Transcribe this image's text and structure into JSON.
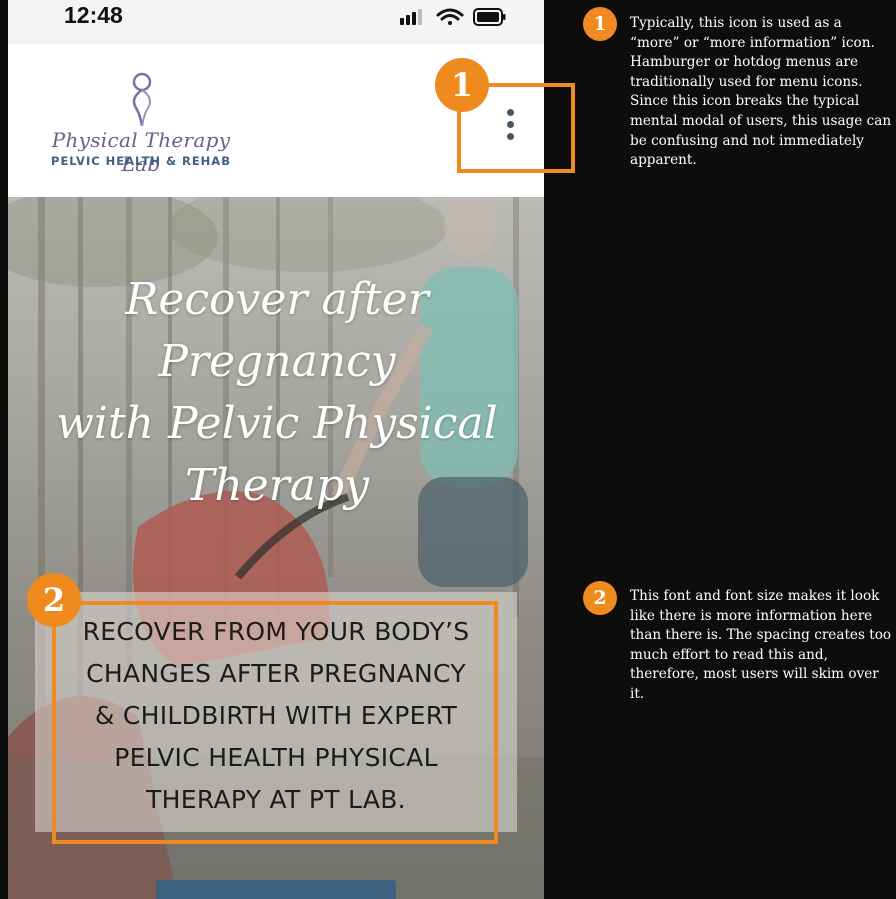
{
  "status_bar": {
    "time": "12:48",
    "icons": [
      "signal-icon",
      "wifi-icon",
      "battery-icon"
    ]
  },
  "header": {
    "logo_script": "Physical Therapy Lab",
    "logo_subtitle": "PELVIC HEALTH & REHAB",
    "menu_icon": "vertical-ellipsis-icon"
  },
  "hero": {
    "title_lines": [
      "Recover after Pregnancy",
      "with Pelvic Physical",
      "Therapy"
    ],
    "body_lines": [
      "RECOVER FROM YOUR BODY’S",
      "CHANGES AFTER PREGNANCY",
      "& CHILDBIRTH WITH EXPERT",
      "PELVIC HEALTH PHYSICAL",
      "THERAPY AT PT LAB."
    ]
  },
  "annotations": [
    {
      "number": "1",
      "text": "Typically, this icon is used as a “more” or “more information” icon. Hamburger or hotdog menus are traditionally used for menu icons. Since this icon breaks the typical mental modal of users, this usage can be confusing and not immediately apparent."
    },
    {
      "number": "2",
      "text": "This font and font size makes it look like there is more information here than there is. The spacing creates too much effort to read this and, therefore, most users will skim over it."
    }
  ],
  "colors": {
    "annotation_accent": "#ef8a1f",
    "background": "#0d0d0d",
    "logo_purple": "#6a5f8a",
    "logo_blue": "#3f5f86",
    "cta_blue": "#3e6180"
  }
}
